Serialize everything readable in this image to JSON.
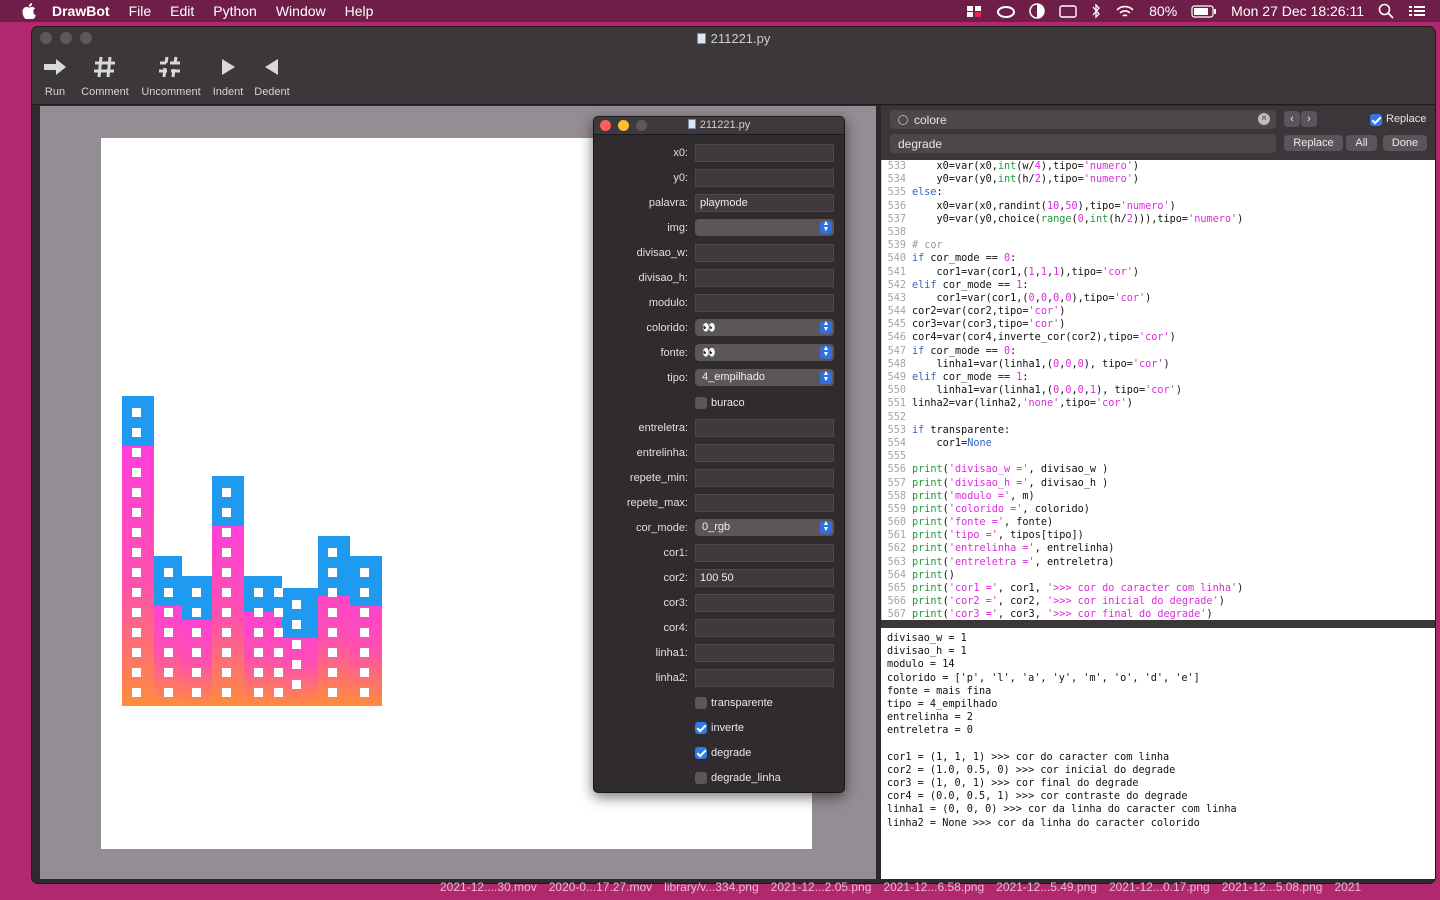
{
  "menubar": {
    "app": "DrawBot",
    "items": [
      "File",
      "Edit",
      "Python",
      "Window",
      "Help"
    ],
    "battery": "80%",
    "clock": "Mon 27 Dec  18:26:11"
  },
  "window": {
    "title": "211221.py",
    "toolbar": [
      {
        "label": "Run",
        "icon": "run-arrow-icon"
      },
      {
        "label": "Comment",
        "icon": "hash-icon"
      },
      {
        "label": "Uncomment",
        "icon": "broken-hash-icon"
      },
      {
        "label": "Indent",
        "icon": "triangle-right-icon"
      },
      {
        "label": "Dedent",
        "icon": "triangle-left-icon"
      }
    ]
  },
  "find": {
    "search": "colore",
    "replace": "degrade",
    "replace_toggle": "Replace",
    "replace_btn": "Replace",
    "all_btn": "All",
    "done_btn": "Done"
  },
  "panel": {
    "title": "211221.py",
    "x0": {
      "label": "x0:",
      "value": ""
    },
    "y0": {
      "label": "y0:",
      "value": ""
    },
    "palavra": {
      "label": "palavra:",
      "value": "playmode"
    },
    "img": {
      "label": "img:",
      "value": ""
    },
    "divisao_w": {
      "label": "divisao_w:",
      "value": ""
    },
    "divisao_h": {
      "label": "divisao_h:",
      "value": ""
    },
    "modulo": {
      "label": "modulo:",
      "value": ""
    },
    "colorido": {
      "label": "colorido:",
      "value": "👀"
    },
    "fonte": {
      "label": "fonte:",
      "value": "👀"
    },
    "tipo": {
      "label": "tipo:",
      "value": "4_empilhado"
    },
    "buraco": {
      "label": "buraco",
      "checked": false
    },
    "entreletra": {
      "label": "entreletra:",
      "value": ""
    },
    "entrelinha": {
      "label": "entrelinha:",
      "value": ""
    },
    "repete_min": {
      "label": "repete_min:",
      "value": ""
    },
    "repete_max": {
      "label": "repete_max:",
      "value": ""
    },
    "cor_mode": {
      "label": "cor_mode:",
      "value": "0_rgb"
    },
    "cor1": {
      "label": "cor1:",
      "value": ""
    },
    "cor2": {
      "label": "cor2:",
      "value": "100 50"
    },
    "cor3": {
      "label": "cor3:",
      "value": ""
    },
    "cor4": {
      "label": "cor4:",
      "value": ""
    },
    "linha1": {
      "label": "linha1:",
      "value": ""
    },
    "linha2": {
      "label": "linha2:",
      "value": ""
    },
    "transparente": {
      "label": "transparente",
      "checked": false
    },
    "inverte": {
      "label": "inverte",
      "checked": true
    },
    "degrade": {
      "label": "degrade",
      "checked": true
    },
    "degrade_linha": {
      "label": "degrade_linha",
      "checked": false
    }
  },
  "code_lines": [
    {
      "n": "533",
      "t": "    x0=var(x0,int(w/4),tipo='numero')"
    },
    {
      "n": "534",
      "t": "    y0=var(y0,int(h/2),tipo='numero')"
    },
    {
      "n": "535",
      "t": "else:"
    },
    {
      "n": "536",
      "t": "    x0=var(x0,randint(10,50),tipo='numero')"
    },
    {
      "n": "537",
      "t": "    y0=var(y0,choice(range(0,int(h/2))),tipo='numero')"
    },
    {
      "n": "538",
      "t": ""
    },
    {
      "n": "539",
      "t": "# cor"
    },
    {
      "n": "540",
      "t": "if cor_mode == 0:"
    },
    {
      "n": "541",
      "t": "    cor1=var(cor1,(1,1,1),tipo='cor')"
    },
    {
      "n": "542",
      "t": "elif cor_mode == 1:"
    },
    {
      "n": "543",
      "t": "    cor1=var(cor1,(0,0,0,0),tipo='cor')"
    },
    {
      "n": "544",
      "t": "cor2=var(cor2,tipo='cor')"
    },
    {
      "n": "545",
      "t": "cor3=var(cor3,tipo='cor')"
    },
    {
      "n": "546",
      "t": "cor4=var(cor4,inverte_cor(cor2),tipo='cor')"
    },
    {
      "n": "547",
      "t": "if cor_mode == 0:"
    },
    {
      "n": "548",
      "t": "    linha1=var(linha1,(0,0,0), tipo='cor')"
    },
    {
      "n": "549",
      "t": "elif cor_mode == 1:"
    },
    {
      "n": "550",
      "t": "    linha1=var(linha1,(0,0,0,1), tipo='cor')"
    },
    {
      "n": "551",
      "t": "linha2=var(linha2,'none',tipo='cor')"
    },
    {
      "n": "552",
      "t": ""
    },
    {
      "n": "553",
      "t": "if transparente:"
    },
    {
      "n": "554",
      "t": "    cor1=None"
    },
    {
      "n": "555",
      "t": ""
    },
    {
      "n": "556",
      "t": "print('divisao_w =', divisao_w )"
    },
    {
      "n": "557",
      "t": "print('divisao_h =', divisao_h )"
    },
    {
      "n": "558",
      "t": "print('modulo =', m)"
    },
    {
      "n": "559",
      "t": "print('colorido =', colorido)"
    },
    {
      "n": "560",
      "t": "print('fonte =', fonte)"
    },
    {
      "n": "561",
      "t": "print('tipo =', tipos[tipo])"
    },
    {
      "n": "562",
      "t": "print('entrelinha =', entrelinha)"
    },
    {
      "n": "563",
      "t": "print('entreletra =', entreletra)"
    },
    {
      "n": "564",
      "t": "print()"
    },
    {
      "n": "565",
      "t": "print('cor1 =', cor1, '>>> cor do caracter com linha')"
    },
    {
      "n": "566",
      "t": "print('cor2 =', cor2, '>>> cor inicial do degrade')"
    },
    {
      "n": "567",
      "t": "print('cor3 =', cor3, '>>> cor final do degrade')"
    }
  ],
  "console_lines": [
    "divisao_w = 1",
    "divisao_h = 1",
    "modulo = 14",
    "colorido = ['p', 'l', 'a', 'y', 'm', 'o', 'd', 'e']",
    "fonte = mais fina",
    "tipo = 4_empilhado",
    "entrelinha = 2",
    "entreletra = 0",
    "",
    "cor1 = (1, 1, 1) >>> cor do caracter com linha",
    "cor2 = (1.0, 0.5, 0) >>> cor inicial do degrade",
    "cor3 = (1, 0, 1) >>> cor final do degrade",
    "cor4 = (0.0, 0.5, 1) >>> cor contraste do degrade",
    "linha1 = (0, 0, 0) >>> cor da linha do caracter com linha",
    "linha2 = None >>> cor da linha do caracter colorido"
  ],
  "dock_files": [
    "2021-12....30.mov",
    "2020-0...17.27.mov",
    "library/v...334.png",
    "2021-12...2.05.png",
    "2021-12...6.58.png",
    "2021-12...5.49.png",
    "2021-12...0.17.png",
    "2021-12...5.08.png",
    "2021"
  ],
  "colors": {
    "accent": "#2f7ae8",
    "pink": "#ff3de0",
    "orange": "#ff8c3a",
    "blue": "#1e9bf0"
  }
}
